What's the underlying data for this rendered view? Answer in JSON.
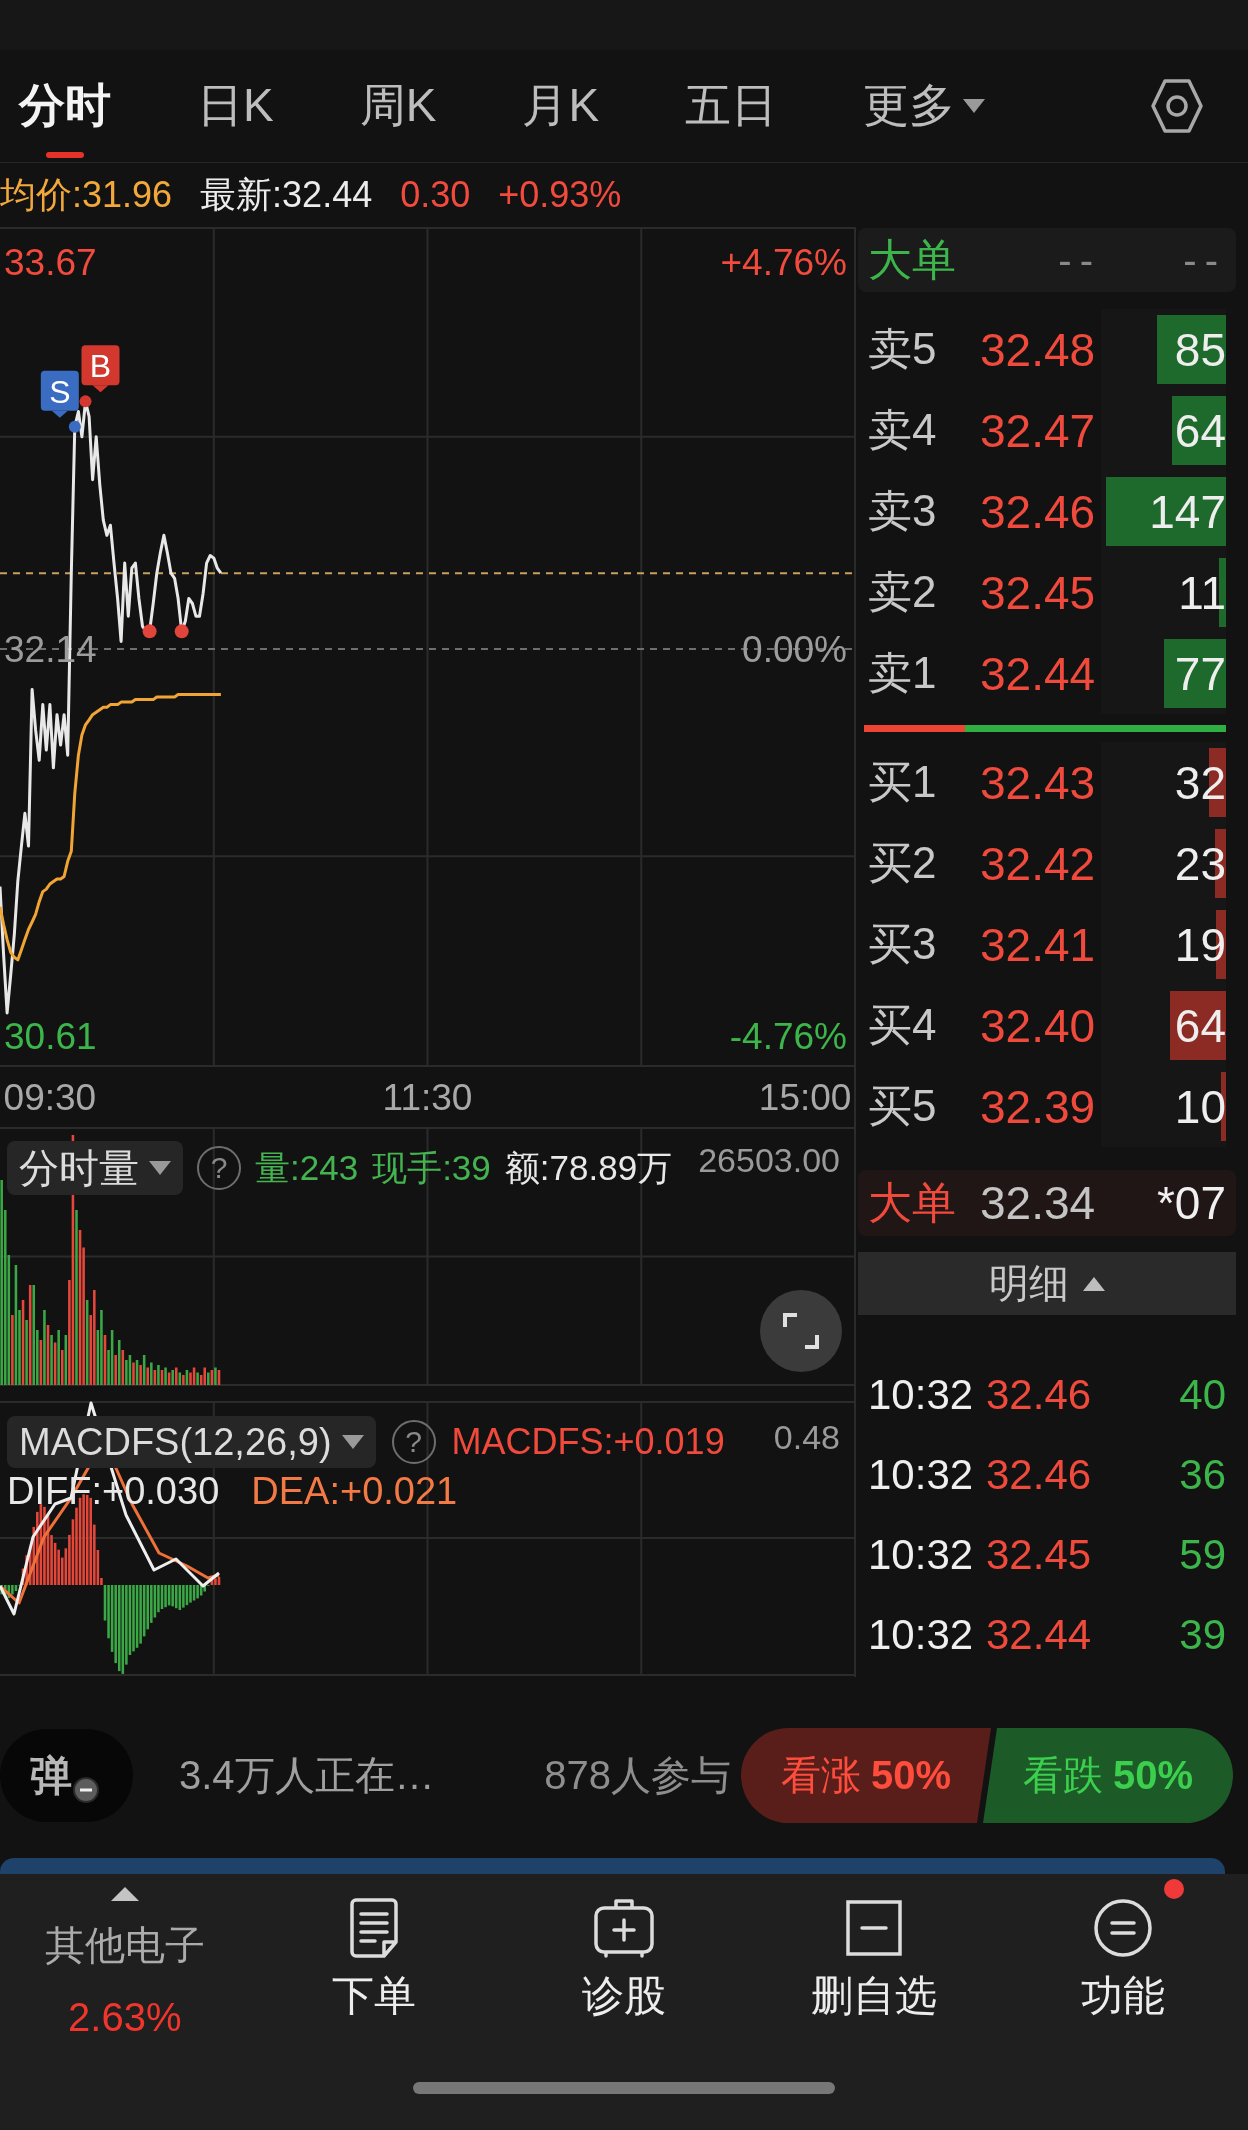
{
  "tabs": [
    {
      "label": "分时",
      "selected": true,
      "dropdown": false
    },
    {
      "label": "日K",
      "selected": false,
      "dropdown": false
    },
    {
      "label": "周K",
      "selected": false,
      "dropdown": false
    },
    {
      "label": "月K",
      "selected": false,
      "dropdown": false
    },
    {
      "label": "五日",
      "selected": false,
      "dropdown": false
    },
    {
      "label": "更多",
      "selected": false,
      "dropdown": true
    }
  ],
  "quote": [
    {
      "text": "均价:31.96",
      "kind": "average"
    },
    {
      "text": "最新:32.44",
      "kind": "latest"
    },
    {
      "text": "0.30",
      "kind": "up"
    },
    {
      "text": "+0.93%",
      "kind": "up"
    }
  ],
  "price_chart": {
    "right_labels": [
      {
        "text": "+4.76%",
        "kind": "up"
      },
      {
        "text": "0.00%",
        "kind": "flat"
      },
      {
        "text": "-4.76%",
        "kind": "down"
      }
    ],
    "chart_data": {
      "type": "line",
      "categories": [
        null,
        null,
        null,
        null,
        null,
        null,
        null,
        null,
        null,
        null,
        null,
        null,
        null,
        null,
        "09:30",
        null,
        null,
        null,
        null,
        null,
        null,
        null,
        null,
        null,
        null,
        null,
        null,
        null,
        null,
        null,
        null,
        null,
        null,
        null,
        null,
        null,
        null,
        null,
        null,
        null,
        null,
        null,
        null,
        null,
        null,
        null,
        null,
        null,
        null,
        null,
        null,
        null,
        null,
        null,
        null,
        null,
        null,
        null,
        null,
        null,
        null,
        null,
        null,
        null,
        null,
        null,
        null,
        null,
        null,
        null,
        null,
        null,
        null,
        null,
        null,
        null,
        null,
        null,
        null,
        null,
        null,
        null,
        null,
        null,
        null,
        null,
        null,
        null,
        null,
        null,
        null,
        null,
        null,
        null,
        null,
        null,
        null,
        null,
        null,
        null,
        null,
        null,
        null,
        null,
        null,
        null,
        null,
        null,
        null,
        null,
        null,
        null,
        null,
        null,
        null,
        null,
        null,
        null,
        null,
        null,
        "11:30",
        null,
        null,
        null,
        null,
        null,
        null,
        null,
        null,
        null,
        null,
        null,
        null,
        null,
        null,
        null,
        null,
        null,
        null,
        null,
        null,
        null,
        null,
        null,
        null,
        null,
        null,
        null,
        null,
        null,
        null,
        null,
        null,
        null,
        null,
        null,
        null,
        null,
        null,
        null,
        null,
        null,
        null,
        null,
        null,
        null,
        null,
        null,
        null,
        null,
        null,
        null,
        null,
        null,
        null,
        null,
        null,
        null,
        null,
        null,
        null,
        null,
        null,
        null,
        null,
        null,
        null,
        null,
        null,
        null,
        null,
        null,
        null,
        null,
        null,
        null,
        null,
        null,
        null,
        null,
        null,
        null,
        null,
        null,
        null,
        null,
        null,
        null,
        null,
        null,
        null,
        null,
        null,
        null,
        null,
        null,
        null,
        null,
        null,
        null,
        null,
        null,
        null,
        null,
        null,
        null,
        "15:00",
        null,
        null,
        null,
        null,
        null,
        null,
        null,
        null,
        null,
        null,
        null,
        null,
        null,
        null
      ],
      "ylim": [
        30.49,
        33.81
      ],
      "yticks": [
        30.61,
        32.14,
        33.67
      ],
      "series": [
        {
          "color": "#e8e8e8",
          "values": [
            31.2,
            30.93,
            30.7,
            30.85,
            31.01,
            31.22,
            31.36,
            31.49,
            31.36,
            31.98,
            31.82,
            31.7,
            31.92,
            31.74,
            31.92,
            31.67,
            31.88,
            31.76,
            31.88,
            31.72,
            32.44,
            33.02,
            33.08,
            32.98,
            33.12,
            33.06,
            32.81,
            32.98,
            32.79,
            32.65,
            32.59,
            32.63,
            32.48,
            32.34,
            32.17,
            32.48,
            32.27,
            32.46,
            32.48,
            32.34,
            32.23,
            32.21,
            32.21,
            32.32,
            32.44,
            32.52,
            32.59,
            32.52,
            32.44,
            32.42,
            32.34,
            32.21,
            32.25,
            32.34,
            32.32,
            32.27,
            32.27,
            32.36,
            32.48,
            32.51,
            32.5,
            32.46,
            32.44,
            null,
            null,
            null,
            null,
            null,
            null,
            null,
            null,
            null,
            null,
            null,
            null,
            null,
            null,
            null,
            null,
            null,
            null,
            null,
            null,
            null,
            null,
            null,
            null,
            null,
            null,
            null,
            null,
            null,
            null,
            null,
            null,
            null,
            null,
            null,
            null,
            null,
            null,
            null,
            null,
            null,
            null,
            null,
            null,
            null,
            null,
            null,
            null,
            null,
            null,
            null,
            null,
            null,
            null,
            null,
            null,
            null,
            null,
            null,
            null,
            null,
            null,
            null,
            null,
            null,
            null,
            null,
            null,
            null,
            null,
            null,
            null,
            null,
            null,
            null,
            null,
            null,
            null,
            null,
            null,
            null,
            null,
            null,
            null,
            null,
            null,
            null,
            null,
            null,
            null,
            null,
            null,
            null,
            null,
            null,
            null,
            null,
            null,
            null,
            null,
            null,
            null,
            null,
            null,
            null,
            null,
            null,
            null,
            null,
            null,
            null,
            null,
            null,
            null,
            null,
            null,
            null,
            null,
            null,
            null,
            null,
            null,
            null,
            null,
            null,
            null,
            null,
            null,
            null,
            null,
            null,
            null,
            null,
            null,
            null,
            null,
            null,
            null,
            null,
            null,
            null,
            null,
            null,
            null,
            null,
            null,
            null,
            null,
            null,
            null,
            null,
            null,
            null,
            null,
            null,
            null,
            null,
            null,
            null,
            null,
            null,
            null,
            null,
            null,
            null,
            null,
            null,
            null,
            null,
            null,
            null,
            null,
            null,
            null,
            null,
            null,
            null,
            null
          ]
        },
        {
          "color": "#f0a534",
          "values": [
            31.12,
            31.05,
            30.99,
            30.94,
            30.92,
            30.91,
            30.95,
            30.99,
            31.03,
            31.06,
            31.09,
            31.14,
            31.18,
            31.19,
            31.21,
            31.22,
            31.23,
            31.23,
            31.24,
            31.3,
            31.34,
            31.57,
            31.72,
            31.8,
            31.84,
            31.86,
            31.88,
            31.89,
            31.9,
            31.91,
            31.91,
            31.92,
            31.92,
            31.92,
            31.93,
            31.93,
            31.93,
            31.93,
            31.94,
            31.94,
            31.94,
            31.94,
            31.94,
            31.94,
            31.95,
            31.95,
            31.95,
            31.95,
            31.95,
            31.95,
            31.96,
            31.96,
            31.96,
            31.96,
            31.96,
            31.96,
            31.96,
            31.96,
            31.96,
            31.96,
            31.96,
            31.96,
            31.96,
            null,
            null,
            null,
            null,
            null,
            null,
            null,
            null,
            null,
            null,
            null,
            null,
            null,
            null,
            null,
            null,
            null,
            null,
            null,
            null,
            null,
            null,
            null,
            null,
            null,
            null,
            null,
            null,
            null,
            null,
            null,
            null,
            null,
            null,
            null,
            null,
            null,
            null,
            null,
            null,
            null,
            null,
            null,
            null,
            null,
            null,
            null,
            null,
            null,
            null,
            null,
            null,
            null,
            null,
            null,
            null,
            null,
            null,
            null,
            null,
            null,
            null,
            null,
            null,
            null,
            null,
            null,
            null,
            null,
            null,
            null,
            null,
            null,
            null,
            null,
            null,
            null,
            null,
            null,
            null,
            null,
            null,
            null,
            null,
            null,
            null,
            null,
            null,
            null,
            null,
            null,
            null,
            null,
            null,
            null,
            null,
            null,
            null,
            null,
            null,
            null,
            null,
            null,
            null,
            null,
            null,
            null,
            null,
            null,
            null,
            null,
            null,
            null,
            null,
            null,
            null,
            null,
            null,
            null,
            null,
            null,
            null,
            null,
            null,
            null,
            null,
            null,
            null,
            null,
            null,
            null,
            null,
            null,
            null,
            null,
            null,
            null,
            null,
            null,
            null,
            null,
            null,
            null,
            null,
            null,
            null,
            null,
            null,
            null,
            null,
            null,
            null,
            null,
            null,
            null,
            null,
            null,
            null,
            null,
            null,
            null,
            null,
            null,
            null,
            null,
            null,
            null,
            null,
            null,
            null,
            null,
            null,
            null,
            null,
            null,
            null,
            null,
            null
          ]
        }
      ],
      "ref_lines": [
        {
          "axis": "y",
          "value": 32.14,
          "color": "#6e6e6e"
        },
        {
          "axis": "y",
          "value": 32.44,
          "color": "#c9a060"
        }
      ],
      "annotations": [
        "S",
        "B"
      ]
    }
  },
  "volume_panel": {
    "selector": "分时量",
    "help": "?",
    "stats": [
      {
        "text": "量:243",
        "kind": "volume"
      },
      {
        "text": "现手:39",
        "kind": "volume"
      },
      {
        "text": "额:78.89万",
        "kind": "amount"
      }
    ],
    "max_label": "26503.00"
  },
  "macd_panel": {
    "selector": "MACDFS(12,26,9)",
    "help": "?",
    "stats": [
      {
        "text": "MACDFS:+0.019",
        "kind": "macd"
      }
    ],
    "lines": [
      {
        "text": "DIFF:+0.030",
        "kind": "diff"
      },
      {
        "text": "DEA:+0.021",
        "kind": "dea"
      }
    ],
    "max_label": "0.48"
  },
  "order_book": {
    "header": {
      "label": "大单",
      "values": [
        "--",
        "--"
      ]
    },
    "asks": [
      {
        "label": "卖5",
        "price": "32.48",
        "volume": "85",
        "level": 0.55
      },
      {
        "label": "卖4",
        "price": "32.47",
        "volume": "64",
        "level": 0.43
      },
      {
        "label": "卖3",
        "price": "32.46",
        "volume": "147",
        "level": 0.96
      },
      {
        "label": "卖2",
        "price": "32.45",
        "volume": "11",
        "level": 0.06
      },
      {
        "label": "卖1",
        "price": "32.44",
        "volume": "77",
        "level": 0.5
      }
    ],
    "ratio": {
      "level": 0.28
    },
    "bids": [
      {
        "label": "买1",
        "price": "32.43",
        "volume": "32",
        "level": 0.14
      },
      {
        "label": "买2",
        "price": "32.42",
        "volume": "23",
        "level": 0.09
      },
      {
        "label": "买3",
        "price": "32.41",
        "volume": "19",
        "level": 0.08
      },
      {
        "label": "买4",
        "price": "32.40",
        "volume": "64",
        "level": 0.45
      },
      {
        "label": "买5",
        "price": "32.39",
        "volume": "10",
        "level": 0.04
      }
    ],
    "big_order": {
      "label": "大单",
      "price": "32.34",
      "volume": "*07"
    },
    "detail_tab": "明细"
  },
  "trades": [
    {
      "time": "10:32",
      "price": "32.46",
      "volume": "40",
      "kind": "sell"
    },
    {
      "time": "10:32",
      "price": "32.46",
      "volume": "36",
      "kind": "sell"
    },
    {
      "time": "10:32",
      "price": "32.45",
      "volume": "59",
      "kind": "sell"
    },
    {
      "time": "10:32",
      "price": "32.44",
      "volume": "39",
      "kind": "sell"
    }
  ],
  "live_bar": {
    "danmaku": "弹",
    "viewers": "3.4万人正在…",
    "participants": "878人参与",
    "votes": [
      {
        "label": "看涨",
        "percent": "50%",
        "kind": "bull"
      },
      {
        "label": "看跌",
        "percent": "50%",
        "kind": "bear"
      }
    ]
  },
  "bottom_nav": {
    "sector": {
      "name": "其他电子",
      "change": "2.63%"
    },
    "items": [
      {
        "label": "下单",
        "kind": "order",
        "badge": false
      },
      {
        "label": "诊股",
        "kind": "diagnose",
        "badge": false
      },
      {
        "label": "删自选",
        "kind": "unwatch",
        "badge": false
      },
      {
        "label": "功能",
        "kind": "functions",
        "badge": true
      }
    ]
  }
}
